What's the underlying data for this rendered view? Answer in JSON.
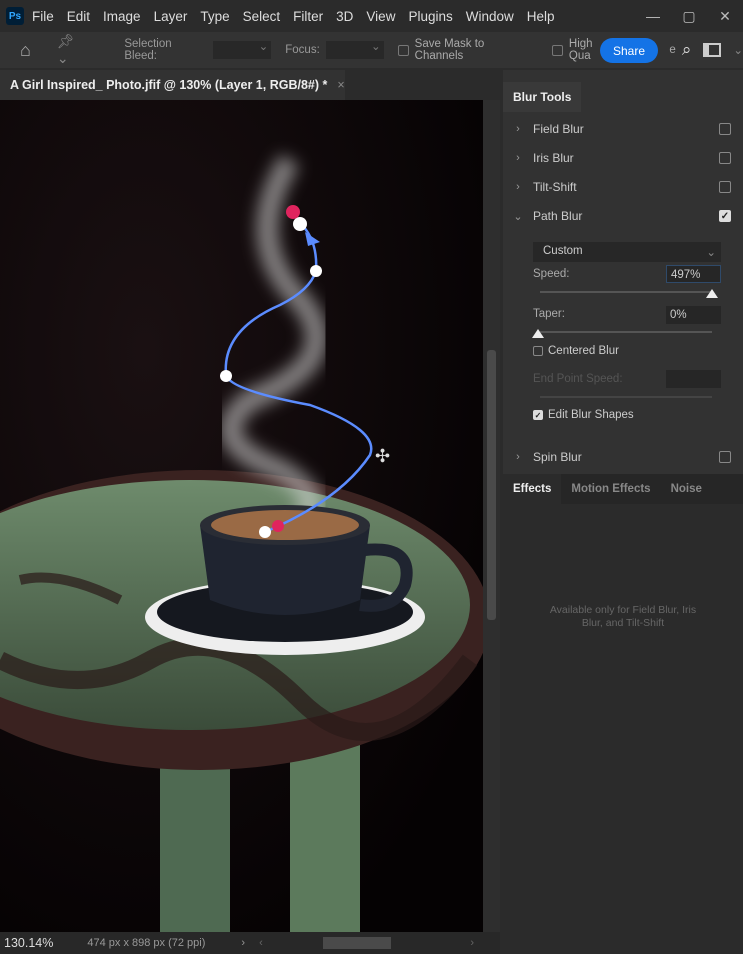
{
  "app": {
    "logo": "Ps"
  },
  "menu": [
    "File",
    "Edit",
    "Image",
    "Layer",
    "Type",
    "Select",
    "Filter",
    "3D",
    "View",
    "Plugins",
    "Window",
    "Help"
  ],
  "window_controls": [
    "—",
    "▢",
    "✕"
  ],
  "options": {
    "selection_bleed_label": "Selection Bleed:",
    "focus_label": "Focus:",
    "save_mask_label": "Save Mask to Channels",
    "high_quality_label": "High Qua",
    "high_quality_tail": "e",
    "share_label": "Share"
  },
  "document": {
    "tab_title": "A Girl Inspired_ Photo.jfif @ 130% (Layer 1, RGB/8#) *",
    "close": "×"
  },
  "status": {
    "zoom": "130.14%",
    "doc_info": "474 px x 898 px (72 ppi)",
    "arrow": "›"
  },
  "panel": {
    "tab": "Blur Tools",
    "items": [
      {
        "label": "Field Blur",
        "checked": false
      },
      {
        "label": "Iris Blur",
        "checked": false
      },
      {
        "label": "Tilt-Shift",
        "checked": false
      },
      {
        "label": "Path Blur",
        "checked": true,
        "expanded": true
      },
      {
        "label": "Spin Blur",
        "checked": false
      }
    ],
    "path_blur": {
      "preset": "Custom",
      "speed_label": "Speed:",
      "speed_value": "497%",
      "speed_percent": 497,
      "taper_label": "Taper:",
      "taper_value": "0%",
      "taper_percent": 0,
      "centered_blur_label": "Centered Blur",
      "centered_blur": false,
      "end_point_speed_label": "End Point Speed:",
      "edit_blur_shapes_label": "Edit Blur Shapes",
      "edit_blur_shapes": true
    },
    "effects_tabs": [
      "Effects",
      "Motion Effects",
      "Noise"
    ],
    "effects_note": "Available only for Field Blur, Iris Blur, and Tilt-Shift"
  },
  "colors": {
    "accent": "#1473e6",
    "path": "#5b8cff",
    "pin": "#e0245e"
  }
}
